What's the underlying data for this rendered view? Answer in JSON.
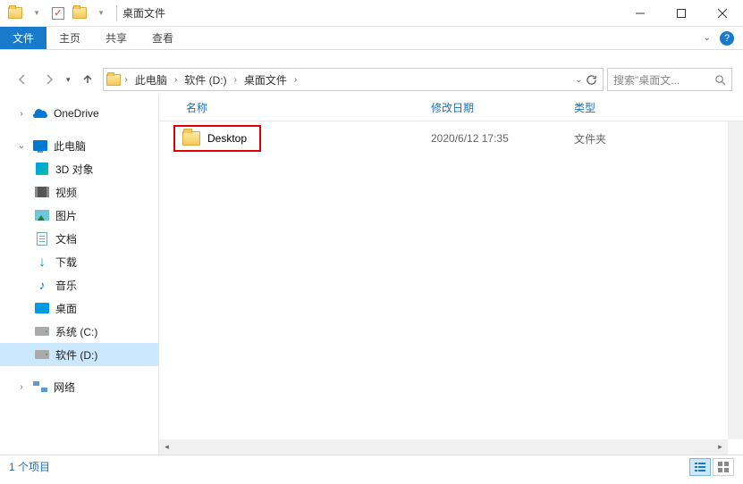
{
  "window": {
    "title": "桌面文件"
  },
  "ribbon": {
    "file": "文件",
    "home": "主页",
    "share": "共享",
    "view": "查看"
  },
  "breadcrumbs": {
    "pc": "此电脑",
    "drive": "软件 (D:)",
    "folder": "桌面文件"
  },
  "search": {
    "placeholder": "搜索\"桌面文..."
  },
  "nav": {
    "onedrive": "OneDrive",
    "pc": "此电脑",
    "obj3d": "3D 对象",
    "video": "视频",
    "pictures": "图片",
    "documents": "文档",
    "downloads": "下载",
    "music": "音乐",
    "desktop": "桌面",
    "drive_c": "系统 (C:)",
    "drive_d": "软件 (D:)",
    "network": "网络"
  },
  "columns": {
    "name": "名称",
    "date": "修改日期",
    "type": "类型"
  },
  "items": [
    {
      "name": "Desktop",
      "date": "2020/6/12 17:35",
      "type": "文件夹"
    }
  ],
  "status": {
    "text": "1 个项目"
  }
}
